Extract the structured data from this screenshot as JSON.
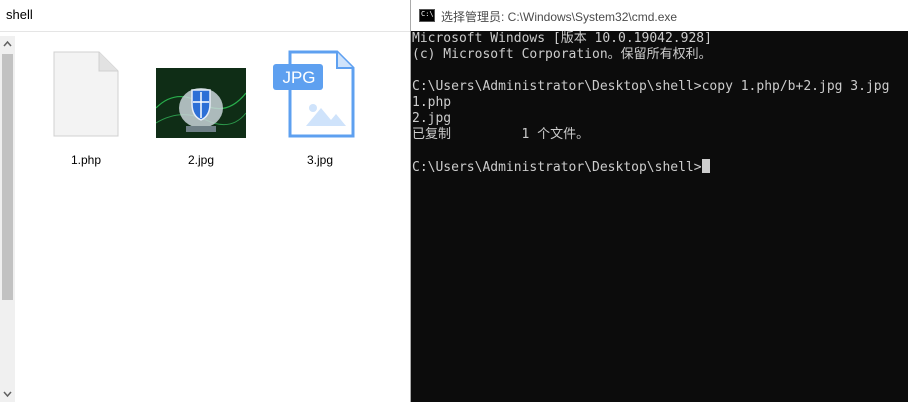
{
  "explorer": {
    "title": "shell",
    "files": [
      {
        "name": "1.php",
        "icon": "blank-file-icon"
      },
      {
        "name": "2.jpg",
        "icon": "image-thumbnail"
      },
      {
        "name": "3.jpg",
        "icon": "jpg-file-icon",
        "badge": "JPG"
      }
    ]
  },
  "cmd": {
    "title": "选择管理员: C:\\Windows\\System32\\cmd.exe",
    "lines": [
      "Microsoft Windows [版本 10.0.19042.928]",
      "(c) Microsoft Corporation。保留所有权利。",
      "",
      "C:\\Users\\Administrator\\Desktop\\shell>copy 1.php/b+2.jpg 3.jpg",
      "1.php",
      "2.jpg",
      "已复制         1 个文件。",
      "",
      "C:\\Users\\Administrator\\Desktop\\shell>"
    ]
  }
}
